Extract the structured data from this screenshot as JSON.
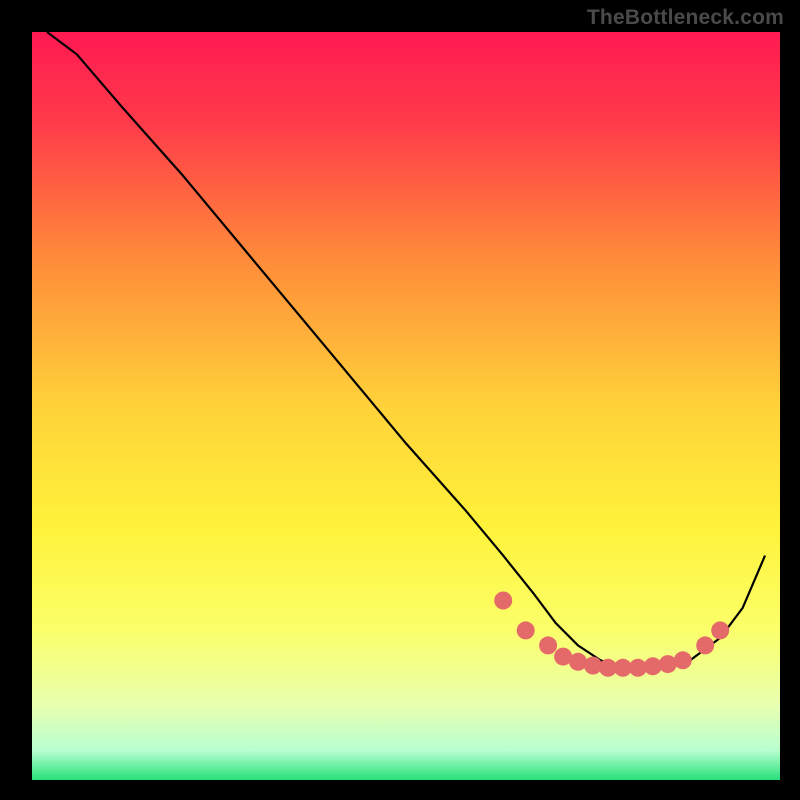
{
  "watermark": "TheBottleneck.com",
  "chart_data": {
    "type": "line",
    "title": "",
    "xlabel": "",
    "ylabel": "",
    "xlim": [
      0,
      100
    ],
    "ylim": [
      0,
      100
    ],
    "grid": false,
    "legend": false,
    "background_gradient": {
      "stops": [
        {
          "offset": 0.0,
          "color": "#ff1a52"
        },
        {
          "offset": 0.12,
          "color": "#ff3a4a"
        },
        {
          "offset": 0.3,
          "color": "#ff8a3a"
        },
        {
          "offset": 0.5,
          "color": "#ffd23a"
        },
        {
          "offset": 0.66,
          "color": "#fff23a"
        },
        {
          "offset": 0.8,
          "color": "#fbff6a"
        },
        {
          "offset": 0.9,
          "color": "#e8ffb0"
        },
        {
          "offset": 0.96,
          "color": "#b8ffd0"
        },
        {
          "offset": 1.0,
          "color": "#28e07a"
        }
      ]
    },
    "series": [
      {
        "name": "curve",
        "color": "#000000",
        "x": [
          2,
          6,
          12,
          20,
          30,
          40,
          50,
          58,
          63,
          67,
          70,
          73,
          76,
          79,
          82,
          85,
          88,
          92,
          95,
          98
        ],
        "y": [
          100,
          97,
          90,
          81,
          69,
          57,
          45,
          36,
          30,
          25,
          21,
          18,
          16,
          15,
          15,
          15,
          16,
          19,
          23,
          30
        ]
      }
    ],
    "highlight_points": {
      "name": "dots",
      "color": "#e46a6a",
      "radius": 9,
      "x": [
        63,
        66,
        69,
        71,
        73,
        75,
        77,
        79,
        81,
        83,
        85,
        87,
        90,
        92
      ],
      "y": [
        24,
        20,
        18,
        16.5,
        15.8,
        15.3,
        15,
        15,
        15,
        15.2,
        15.5,
        16,
        18,
        20
      ]
    }
  }
}
